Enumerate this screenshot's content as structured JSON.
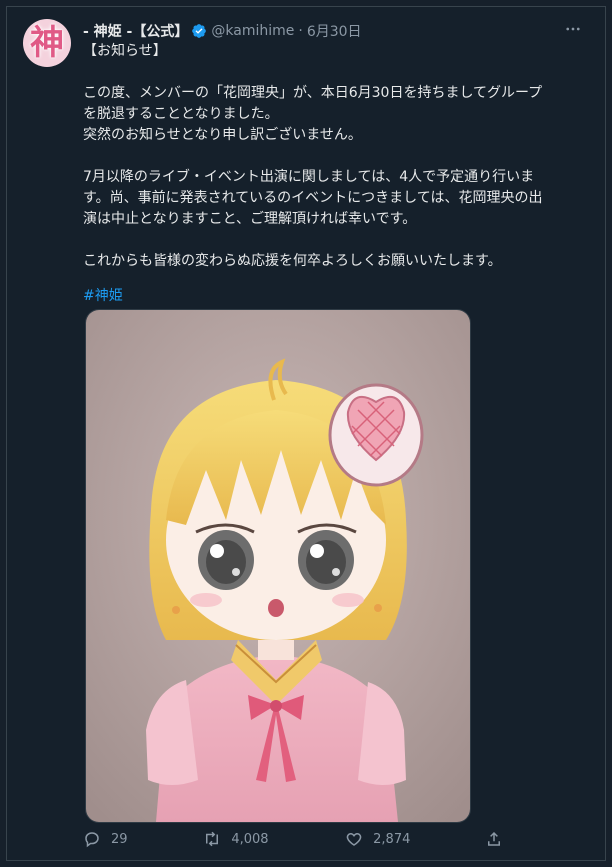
{
  "account": {
    "display_name": "- 神姫 -【公式】",
    "handle": "@kamihime",
    "separator": "·",
    "date": "6月30日",
    "avatar_glyph": "神"
  },
  "tweet": {
    "lines": [
      "【お知らせ】",
      "",
      "この度、メンバーの「花岡理央」が、本日6月30日を持ちましてグループ",
      "を脱退することとなりました。",
      "突然のお知らせとなり申し訳ございません。",
      "",
      "7月以降のライブ・イベント出演に関しましては、4人で予定通り行いま",
      "す。尚、事前に発表されているのイベントにつきましては、花岡理央の出",
      "演は中止となりますこと、ご理解頂ければ幸いです。",
      "",
      "これからも皆様の変わらぬ応援を何卒よろしくお願いいたします。"
    ],
    "hashtag": "#神姫"
  },
  "actions": {
    "replies": "29",
    "retweets": "4,008",
    "likes": "2,874"
  },
  "icons": [
    "verified-badge-icon",
    "more-icon",
    "reply-icon",
    "retweet-icon",
    "like-icon",
    "share-icon"
  ],
  "colors": {
    "background": "#15202b",
    "text": "#e7e9ea",
    "muted": "#8b98a5",
    "link": "#1d9bf0",
    "verified": "#1d9bf0"
  }
}
